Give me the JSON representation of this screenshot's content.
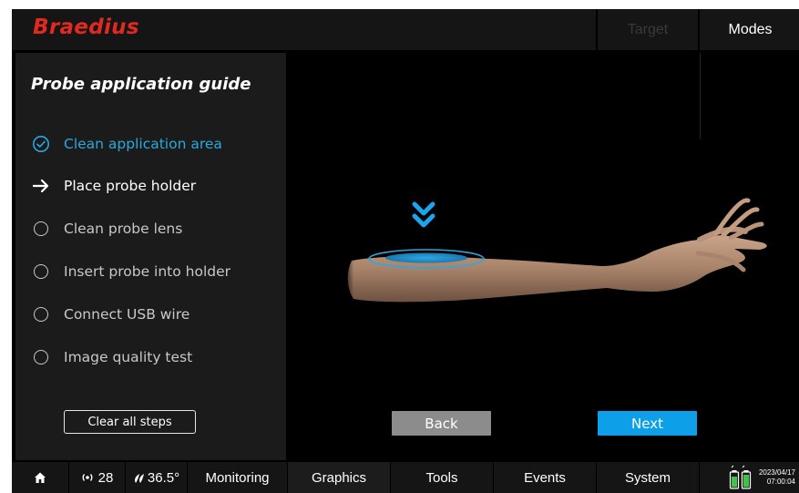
{
  "app": {
    "logo": "Braedius"
  },
  "header": {
    "target_label": "Target",
    "modes_label": "Modes"
  },
  "guide": {
    "title": "Probe application guide",
    "steps": [
      {
        "label": "Clean application area",
        "state": "done"
      },
      {
        "label": "Place probe holder",
        "state": "current"
      },
      {
        "label": "Clean probe lens",
        "state": "todo"
      },
      {
        "label": "Insert probe into holder",
        "state": "todo"
      },
      {
        "label": "Connect USB wire",
        "state": "todo"
      },
      {
        "label": "Image quality test",
        "state": "todo"
      }
    ],
    "clear_label": "Clear all steps"
  },
  "navigation": {
    "back_label": "Back",
    "next_label": "Next"
  },
  "statusbar": {
    "signal_value": "28",
    "temperature_value": "36.5°",
    "tabs": [
      "Monitoring",
      "Graphics",
      "Tools",
      "Events",
      "System"
    ],
    "date": "2023/04/17",
    "time": "07:00:04"
  },
  "colors": {
    "logo": "#e02a20",
    "accent": "#0d9fe8",
    "done_step": "#2aa8e0",
    "back_button": "#8c8c8c"
  },
  "icons": {
    "home": "home-icon",
    "signal": "signal-icon",
    "temperature": "temperature-icon",
    "battery": "battery-icon",
    "step_done": "check-circle-icon",
    "step_current": "arrow-right-icon",
    "step_todo": "empty-circle-icon",
    "placement_marker": "double-chevron-down-icon"
  }
}
